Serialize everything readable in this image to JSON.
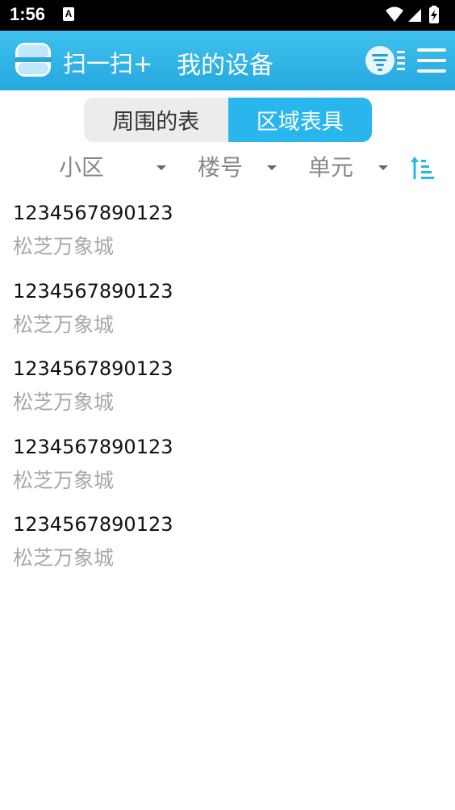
{
  "status_bar": {
    "time": "1:56",
    "notification_letter": "A"
  },
  "header": {
    "scan_label": "扫一扫+",
    "title": "我的设备"
  },
  "tabs": [
    {
      "label": "周围的表",
      "active": false
    },
    {
      "label": "区域表具",
      "active": true
    }
  ],
  "filters": {
    "community": "小区",
    "building": "楼号",
    "unit": "单元"
  },
  "devices": [
    {
      "code": "1234567890123",
      "name": "松芝万象城"
    },
    {
      "code": "1234567890123",
      "name": "松芝万象城"
    },
    {
      "code": "1234567890123",
      "name": "松芝万象城"
    },
    {
      "code": "1234567890123",
      "name": "松芝万象城"
    },
    {
      "code": "1234567890123",
      "name": "松芝万象城"
    }
  ],
  "colors": {
    "header_start": "#3fc1ee",
    "header_end": "#27a8df",
    "accent": "#29b6ec",
    "tab_inactive": "#ececec",
    "secondary_text": "#a8a8a8"
  },
  "icons": {
    "scan": "scan-icon",
    "filter": "filter-icon",
    "menu": "menu-icon",
    "sort": "sort-ascending-icon",
    "wifi": "wifi-icon",
    "signal": "signal-icon",
    "battery": "battery-charging-icon"
  }
}
